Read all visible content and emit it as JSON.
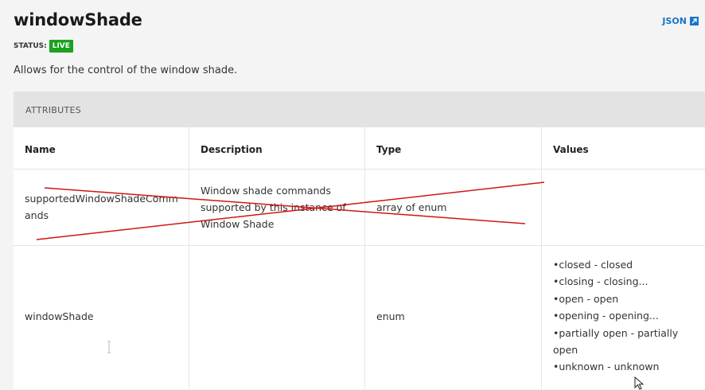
{
  "title": "windowShade",
  "json_link": "JSON",
  "status": {
    "label": "STATUS:",
    "badge": "LIVE"
  },
  "description": "Allows for the control of the window shade.",
  "section_header": "ATTRIBUTES",
  "table": {
    "columns": [
      "Name",
      "Description",
      "Type",
      "Values"
    ],
    "rows": [
      {
        "name": "supportedWindowShadeComm ands",
        "description": "Window shade commands supported by this instance of Window Shade",
        "type": "array of enum",
        "values": []
      },
      {
        "name": "windowShade",
        "description": "",
        "type": "enum",
        "values": [
          "closed - closed",
          "closing - closing...",
          "open - open",
          "opening - opening...",
          "partially open - partially open",
          "unknown - unknown"
        ]
      }
    ]
  },
  "colors": {
    "live_badge": "#1aa11f",
    "link": "#1a73c9",
    "strike": "#d21414"
  }
}
